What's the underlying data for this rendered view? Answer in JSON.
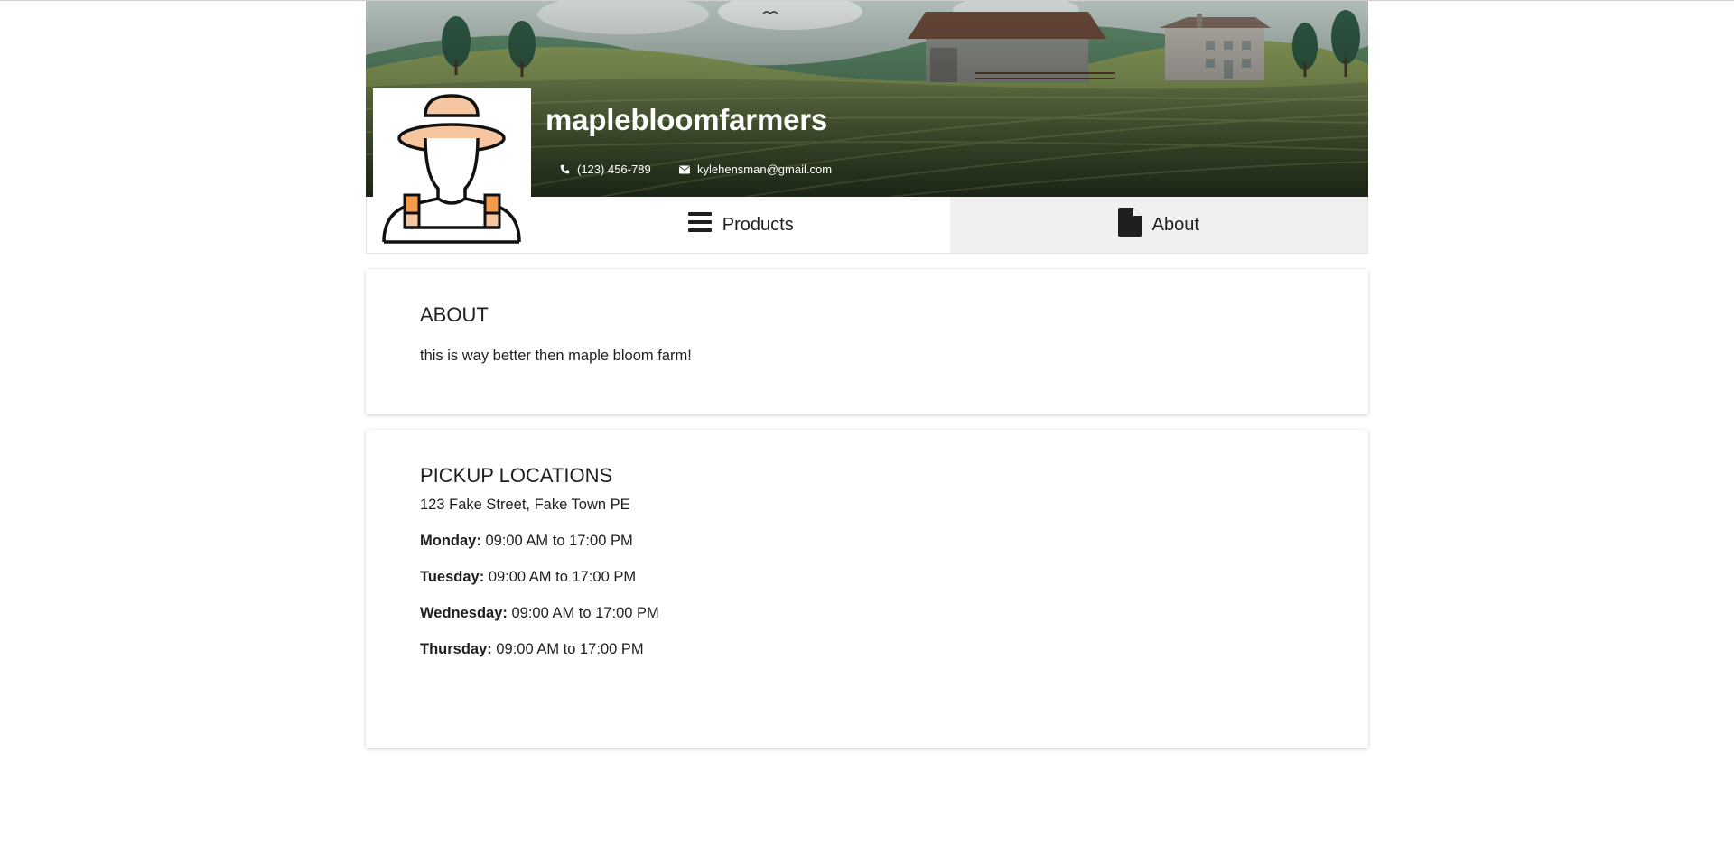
{
  "shop": {
    "name": "maplebloomfarmers",
    "phone": "(123) 456-789",
    "email": "kylehensman@gmail.com",
    "avatar": "farmer-avatar"
  },
  "icons": {
    "phone": "phone-icon",
    "email": "envelope-icon",
    "products": "bars-icon",
    "about": "document-icon"
  },
  "tabs": [
    {
      "label": "Products",
      "active": false
    },
    {
      "label": "About",
      "active": true
    }
  ],
  "about": {
    "heading": "ABOUT",
    "text": "this is way better then maple bloom farm!"
  },
  "pickup": {
    "heading": "PICKUP LOCATIONS",
    "address": "123 Fake Street, Fake Town PE",
    "hours": [
      {
        "day": "Monday:",
        "time": "09:00 AM to 17:00 PM"
      },
      {
        "day": "Tuesday:",
        "time": "09:00 AM to 17:00 PM"
      },
      {
        "day": "Wednesday:",
        "time": "09:00 AM to 17:00 PM"
      },
      {
        "day": "Thursday:",
        "time": "09:00 AM to 17:00 PM"
      }
    ]
  },
  "colors": {
    "active_tab_bg": "#f0f0f0",
    "avatar_skin": "#f6c6a0",
    "avatar_strap": "#f39a4b"
  }
}
